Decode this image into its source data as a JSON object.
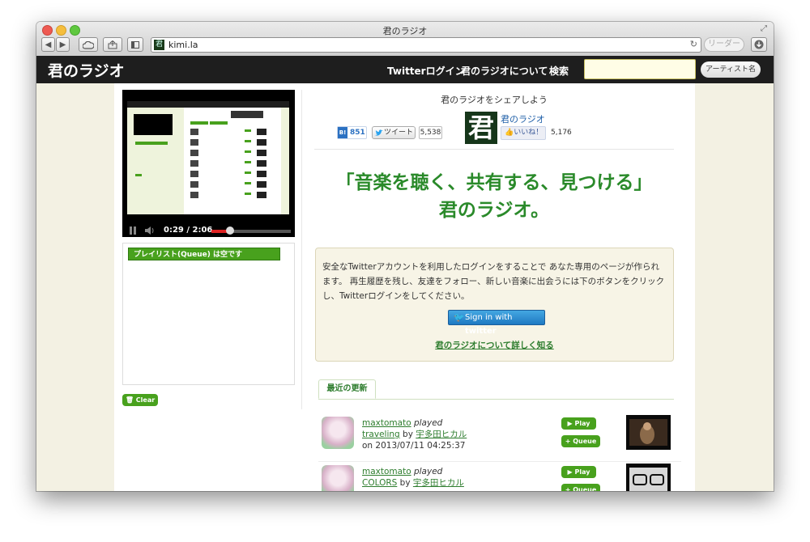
{
  "browser": {
    "window_title": "君のラジオ",
    "url": "kimi.la",
    "reader_label": "リーダー",
    "favicon_glyph": "君"
  },
  "site_nav": {
    "logo": "君のラジオ",
    "links": [
      "Twitterログイン",
      "君のラジオについて",
      "検索"
    ],
    "search_value": "",
    "artist_button": "アーティスト名"
  },
  "player": {
    "time": "0:29 / 2:06",
    "progress": 0.23
  },
  "queue": {
    "header": "プレイリスト(Queue) は空です",
    "clear_label": "Clear"
  },
  "share": {
    "title": "君のラジオをシェアしよう",
    "hatena_icon": "B!",
    "hatena_count": "851",
    "tweet_label": "ツイート",
    "tweet_count": "5,538",
    "page_logo_glyph": "君",
    "page_name": "君のラジオ",
    "like_label": "いいね！",
    "like_count": "5,176"
  },
  "hero": {
    "line1": "「音楽を聴く、共有する、見つける」",
    "line2": "君のラジオ。"
  },
  "login_box": {
    "text": "安全なTwitterアカウントを利用したログインをすることで あなた専用のページが作られます。 再生履歴を残し、友達をフォロー、新しい音楽に出会うには下のボタンをクリックし、Twitterログインをしてください。",
    "signin_prefix": "Sign in with",
    "signin_brand": "twitter",
    "about_link": "君のラジオについて詳しく知る"
  },
  "recent": {
    "tab_label": "最近の更新",
    "items": [
      {
        "user": "maxtomato",
        "verb": "played",
        "track": "traveling",
        "by": "by",
        "artist": "宇多田ヒカル",
        "date": "on 2013/07/11 04:25:37"
      },
      {
        "user": "maxtomato",
        "verb": "played",
        "track": "COLORS",
        "by": "by",
        "artist": "宇多田ヒカル",
        "date": ""
      }
    ],
    "play_label": "Play",
    "queue_label": "Queue"
  }
}
